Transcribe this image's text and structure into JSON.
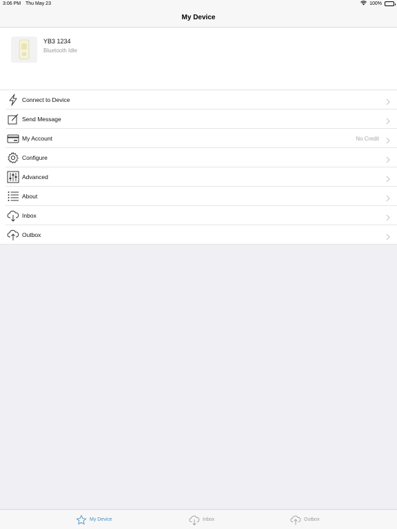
{
  "status_bar": {
    "time": "3:06 PM",
    "date": "Thu May 23",
    "battery": "100%"
  },
  "nav": {
    "title": "My Device"
  },
  "device": {
    "name": "YB3 1234",
    "status": "Bluetooth Idle"
  },
  "menu": {
    "items": [
      {
        "label": "Connect to Device",
        "icon": "lightning-icon"
      },
      {
        "label": "Send Message",
        "icon": "compose-icon"
      },
      {
        "label": "My Account",
        "icon": "credit-card-icon",
        "detail": "No Credit"
      },
      {
        "label": "Configure",
        "icon": "gear-icon"
      },
      {
        "label": "Advanced",
        "icon": "sliders-icon"
      },
      {
        "label": "About",
        "icon": "list-icon"
      },
      {
        "label": "Inbox",
        "icon": "cloud-download-icon"
      },
      {
        "label": "Outbox",
        "icon": "cloud-upload-icon"
      }
    ]
  },
  "tabbar": {
    "tabs": [
      {
        "label": "My Device",
        "icon": "star-icon",
        "active": true
      },
      {
        "label": "Inbox",
        "icon": "cloud-download-icon",
        "active": false
      },
      {
        "label": "Outbox",
        "icon": "cloud-upload-icon",
        "active": false
      }
    ]
  },
  "colors": {
    "accent": "#4a90c6",
    "background": "#efeff4",
    "secondary_text": "#a8a8a8"
  }
}
